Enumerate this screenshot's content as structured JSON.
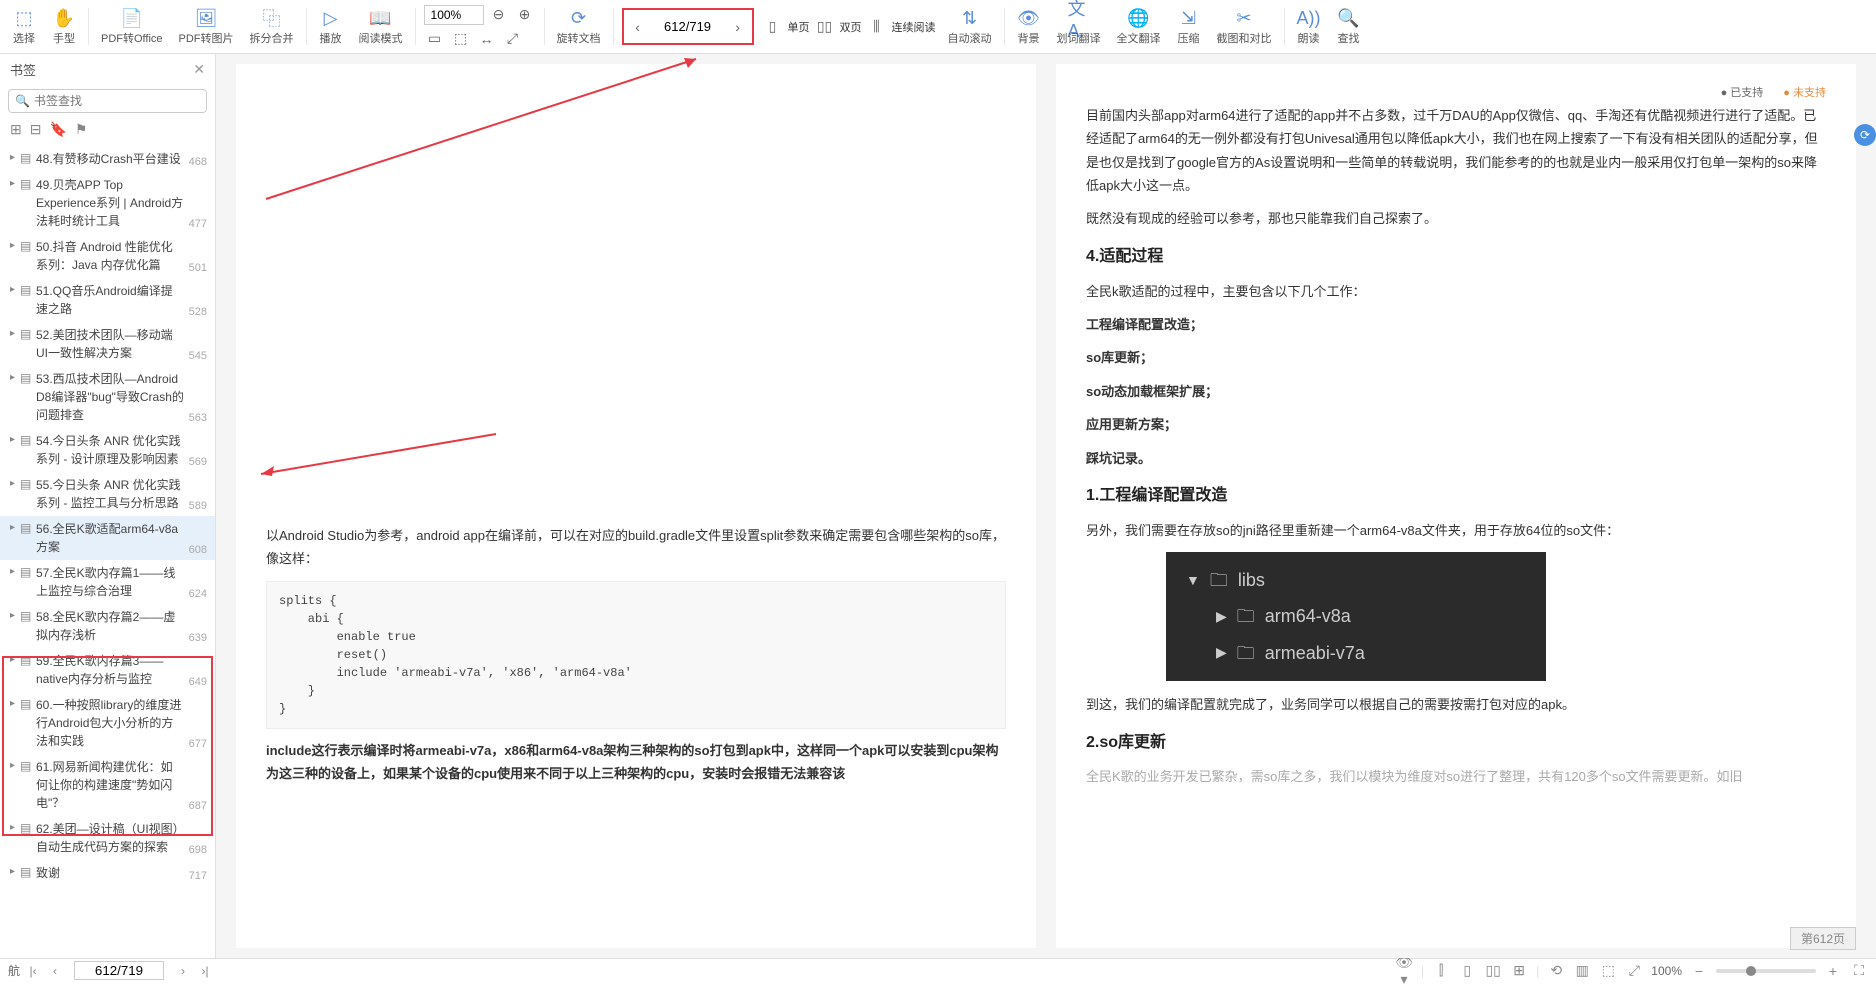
{
  "toolbar": {
    "select": "选择",
    "handtool": "手型",
    "pdf2office": "PDF转Office",
    "pdf2img": "PDF转图片",
    "splitmerge": "拆分合并",
    "play": "播放",
    "readmode": "阅读模式",
    "zoom_value": "100%",
    "rotate": "旋转文档",
    "single": "单页",
    "double": "双页",
    "continuous": "连续阅读",
    "autoscroll": "自动滚动",
    "background": "背景",
    "wordtrans": "划词翻译",
    "fulltrans": "全文翻译",
    "compress": "压缩",
    "compare": "截图和对比",
    "read": "朗读",
    "find": "查找",
    "page_input": "612/719"
  },
  "sidebar": {
    "title": "书签",
    "search_placeholder": "书签查找",
    "items": [
      {
        "title": "48.有赞移动Crash平台建设",
        "page": "468"
      },
      {
        "title": "49.贝壳APP Top Experience系列 | Android方法耗时统计工具",
        "page": "477"
      },
      {
        "title": "50.抖音 Android 性能优化系列：Java 内存优化篇",
        "page": "501"
      },
      {
        "title": "51.QQ音乐Android编译提速之路",
        "page": "528"
      },
      {
        "title": "52.美团技术团队—移动端UI一致性解决方案",
        "page": "545"
      },
      {
        "title": "53.西瓜技术团队—Android D8编译器\"bug\"导致Crash的问题排查",
        "page": "563"
      },
      {
        "title": "54.今日头条 ANR 优化实践系列 - 设计原理及影响因素",
        "page": "569"
      },
      {
        "title": "55.今日头条 ANR 优化实践系列 - 监控工具与分析思路",
        "page": "589"
      },
      {
        "title": "56.全民K歌适配arm64-v8a方案",
        "page": "608",
        "selected": true
      },
      {
        "title": "57.全民K歌内存篇1——线上监控与综合治理",
        "page": "624"
      },
      {
        "title": "58.全民K歌内存篇2——虚拟内存浅析",
        "page": "639"
      },
      {
        "title": "59.全民K歌内存篇3——native内存分析与监控",
        "page": "649"
      },
      {
        "title": "60.一种按照library的维度进行Android包大小分析的方法和实践",
        "page": "677"
      },
      {
        "title": "61.网易新闻构建优化：如何让你的构建速度\"势如闪电\"？",
        "page": "687"
      },
      {
        "title": "62.美团—设计稿（UI视图）自动生成代码方案的探索",
        "page": "698"
      },
      {
        "title": "致谢",
        "page": "717"
      }
    ]
  },
  "doc": {
    "legend_sup": "已支持",
    "legend_unsup": "未支持",
    "intro1": "目前国内头部app对arm64进行了适配的app并不占多数，过千万DAU的App仅微信、qq、手淘还有优酷视频进行进行了适配。已经适配了arm64的无一例外都没有打包Univesal通用包以降低apk大小，我们也在网上搜索了一下有没有相关团队的适配分享，但是也仅是找到了google官方的As设置说明和一些简单的转载说明，我们能参考的的也就是业内一般采用仅打包单一架构的so来降低apk大小这一点。",
    "intro2": "既然没有现成的经验可以参考，那也只能靠我们自己探索了。",
    "h_process": "4.适配过程",
    "process_intro": "全民k歌适配的过程中，主要包含以下几个工作：",
    "w1": "工程编译配置改造；",
    "w2": "so库更新；",
    "w3": "so动态加载框架扩展；",
    "w4": "应用更新方案；",
    "w5": "踩坑记录。",
    "h_build": "1.工程编译配置改造",
    "build_p1": "以Android Studio为参考，android app在编译前，可以在对应的build.gradle文件里设置split参数来确定需要包含哪些架构的so库，像这样：",
    "code": "splits {\n    abi {\n        enable true\n        reset()\n        include 'armeabi-v7a', 'x86', 'arm64-v8a'\n    }\n}",
    "build_p2": "include这行表示编译时将armeabi-v7a，x86和arm64-v8a架构三种架构的so打包到apk中，这样同一个apk可以安装到cpu架构为这三种的设备上，如果某个设备的cpu使用来不同于以上三种架构的cpu，安装时会报错无法兼容该",
    "jni_p": "另外，我们需要在存放so的jni路径里重新建一个arm64-v8a文件夹，用于存放64位的so文件：",
    "libs": "libs",
    "lib1": "arm64-v8a",
    "lib2": "armeabi-v7a",
    "done_p": "到这，我们的编译配置就完成了，业务同学可以根据自己的需要按需打包对应的apk。",
    "h_so": "2.so库更新",
    "so_p": "全民K歌的业务开发已繁杂，需so库之多，我们以模块为维度对so进行了整理，共有120多个so文件需要更新。如旧"
  },
  "page_badge": "第612页",
  "statusbar": {
    "nav_label": "航",
    "page": "612/719",
    "zoom": "100%"
  }
}
